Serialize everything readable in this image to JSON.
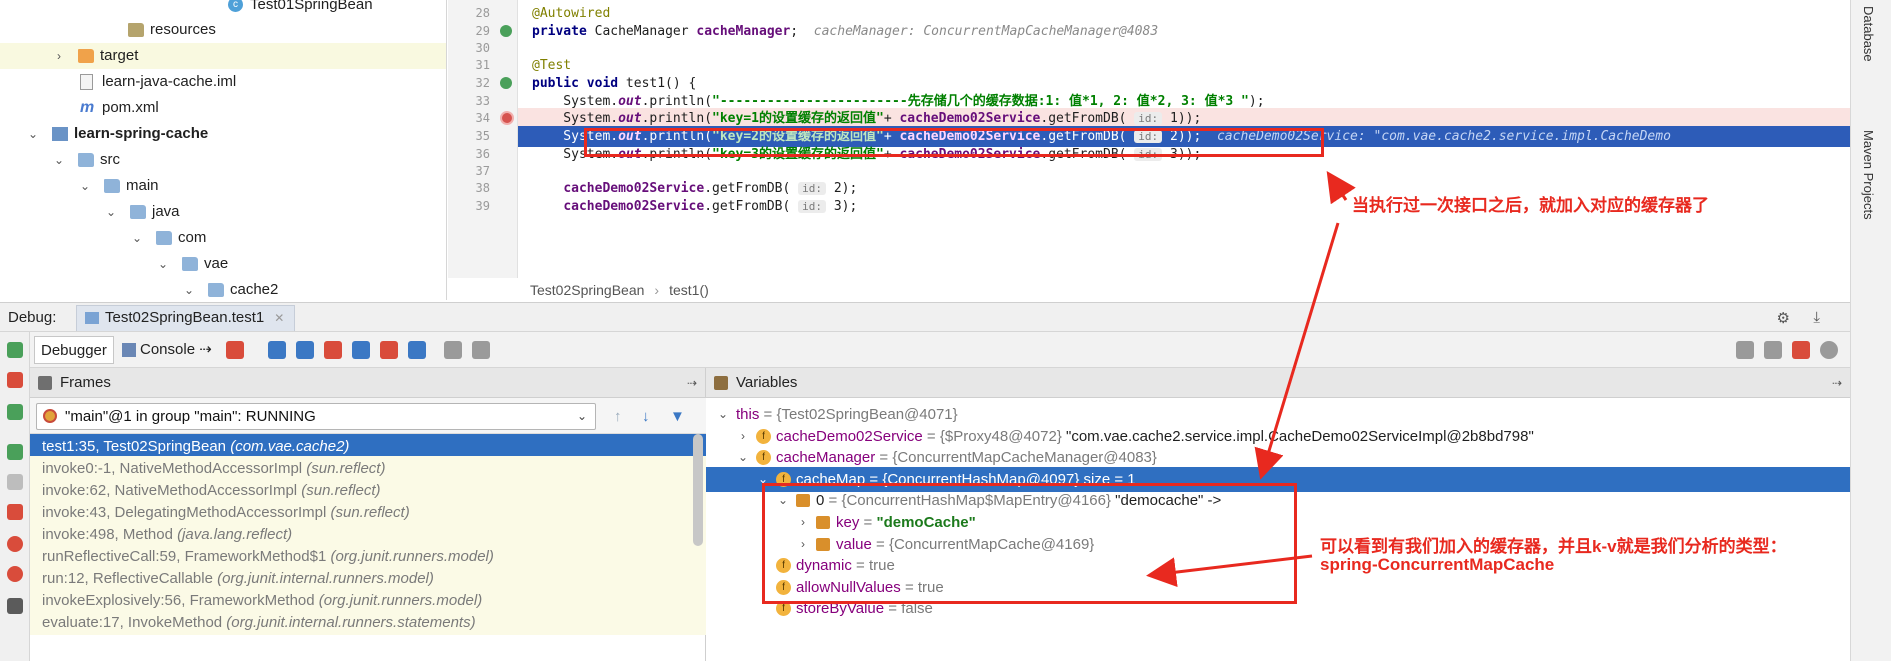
{
  "project_tree": [
    {
      "label": "Test01SpringBean",
      "icon": "cls",
      "indent": 228,
      "arrow": ""
    },
    {
      "label": "resources",
      "icon": "folder res",
      "indent": 128,
      "arrow": ""
    },
    {
      "label": "target",
      "icon": "folder orange",
      "indent": 78,
      "arrow": "›",
      "highlight": true
    },
    {
      "label": "learn-java-cache.iml",
      "icon": "file",
      "indent": 80,
      "arrow": ""
    },
    {
      "label": "pom.xml",
      "icon": "maven",
      "indent": 80,
      "arrow": ""
    },
    {
      "label": "learn-spring-cache",
      "icon": "module",
      "indent": 52,
      "arrow": "⌄",
      "bold": true
    },
    {
      "label": "src",
      "icon": "folder",
      "indent": 78,
      "arrow": "⌄"
    },
    {
      "label": "main",
      "icon": "folder",
      "indent": 104,
      "arrow": "⌄"
    },
    {
      "label": "java",
      "icon": "folder",
      "indent": 130,
      "arrow": "⌄"
    },
    {
      "label": "com",
      "icon": "folder",
      "indent": 156,
      "arrow": "⌄"
    },
    {
      "label": "vae",
      "icon": "folder",
      "indent": 182,
      "arrow": "⌄"
    },
    {
      "label": "cache2",
      "icon": "folder",
      "indent": 208,
      "arrow": "⌄"
    }
  ],
  "editor": {
    "line_numbers": [
      "28",
      "29",
      "30",
      "31",
      "32",
      "33",
      "34",
      "35",
      "36",
      "37",
      "38",
      "39"
    ],
    "inline_values": {
      "cache_manager": "cacheManager: ConcurrentMapCacheManager@4083",
      "service": "cacheDemo02Service: \"com.vae.cache2.service.impl.CacheDemo"
    },
    "breadcrumb": [
      "Test02SpringBean",
      "test1()"
    ]
  },
  "right_strip": {
    "database": "Database",
    "maven": "Maven Projects"
  },
  "debug_header": {
    "label": "Debug:",
    "tab": "Test02SpringBean.test1"
  },
  "toolbar": {
    "debugger_tab": "Debugger",
    "console_tab": "Console"
  },
  "frames": {
    "title": "Frames",
    "thread": "\"main\"@1 in group \"main\": RUNNING",
    "rows": [
      {
        "method": "test1:35, Test02SpringBean ",
        "pkg": "(com.vae.cache2)",
        "selected": true
      },
      {
        "method": "invoke0:-1, NativeMethodAccessorImpl ",
        "pkg": "(sun.reflect)"
      },
      {
        "method": "invoke:62, NativeMethodAccessorImpl ",
        "pkg": "(sun.reflect)"
      },
      {
        "method": "invoke:43, DelegatingMethodAccessorImpl ",
        "pkg": "(sun.reflect)"
      },
      {
        "method": "invoke:498, Method ",
        "pkg": "(java.lang.reflect)"
      },
      {
        "method": "runReflectiveCall:59, FrameworkMethod$1 ",
        "pkg": "(org.junit.runners.model)"
      },
      {
        "method": "run:12, ReflectiveCallable ",
        "pkg": "(org.junit.internal.runners.model)"
      },
      {
        "method": "invokeExplosively:56, FrameworkMethod ",
        "pkg": "(org.junit.runners.model)"
      },
      {
        "method": "evaluate:17, InvokeMethod ",
        "pkg": "(org.junit.internal.runners.statements)"
      }
    ]
  },
  "variables": {
    "title": "Variables",
    "rows": [
      {
        "name": "this",
        "val": " = {Test02SpringBean@4071}",
        "extra": "",
        "indent": 10,
        "exp": "⌄",
        "icon": "none"
      },
      {
        "name": "cacheDemo02Service",
        "val": " = {$Proxy48@4072} ",
        "extra": "\"com.vae.cache2.service.impl.CacheDemo02ServiceImpl@2b8bd798\"",
        "indent": 30,
        "exp": "›",
        "icon": "f"
      },
      {
        "name": "cacheManager",
        "val": " = {ConcurrentMapCacheManager@4083}",
        "extra": "",
        "indent": 30,
        "exp": "⌄",
        "icon": "f"
      },
      {
        "name": "cacheMap",
        "val": " = {ConcurrentHashMap@4097}  size = 1",
        "extra": "",
        "indent": 50,
        "exp": "⌄",
        "icon": "f",
        "selected": true
      },
      {
        "name": "0",
        "val": " = {ConcurrentHashMap$MapEntry@4166} ",
        "extra": "\"democache\" ->",
        "indent": 70,
        "exp": "⌄",
        "icon": "e"
      },
      {
        "name": "key",
        "val": " = ",
        "extra": "\"demoCache\"",
        "indent": 90,
        "exp": "›",
        "icon": "e",
        "strval": true
      },
      {
        "name": "value",
        "val": " = {ConcurrentMapCache@4169}",
        "extra": "",
        "indent": 90,
        "exp": "›",
        "icon": "e"
      },
      {
        "name": "dynamic",
        "val": " = true",
        "extra": "",
        "indent": 50,
        "exp": "",
        "icon": "f"
      },
      {
        "name": "allowNullValues",
        "val": " = true",
        "extra": "",
        "indent": 50,
        "exp": "",
        "icon": "f"
      },
      {
        "name": "storeByValue",
        "val": " = false",
        "extra": "",
        "indent": 50,
        "exp": "",
        "icon": "f"
      }
    ]
  },
  "annotations": {
    "note1": "当执行过一次接口之后，就加入对应的缓存器了",
    "note2_line1": "可以看到有我们加入的缓存器，并且k-v就是我们分析的类型：",
    "note2_line2": "spring-ConcurrentMapCache",
    "color": "#e8291f"
  },
  "colors": {
    "selection": "#2f6fc1",
    "exec_line": "#2d5cb8",
    "breakpoint_line": "#fae3e1"
  }
}
